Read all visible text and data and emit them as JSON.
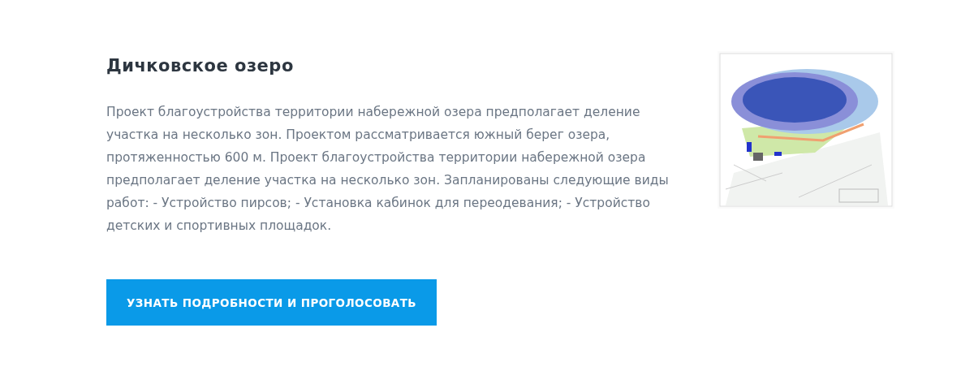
{
  "project": {
    "title": "Дичковское озеро",
    "description": "Проект благоустройства территории набережной озера предполагает деление участка на несколько зон. Проектом рассматривается южный берег озера, протяженностью 600 м. Проект благоустройства территории набережной озера предполагает деление участка на несколько зон. Запланированы следующие виды работ: - Устройство пирсов; - Установка кабинок для переодевания; - Устройство детских и спортивных площадок.",
    "button": "УЗНАТЬ ПОДРОБНОСТИ И ПРОГОЛОСОВАТЬ"
  }
}
